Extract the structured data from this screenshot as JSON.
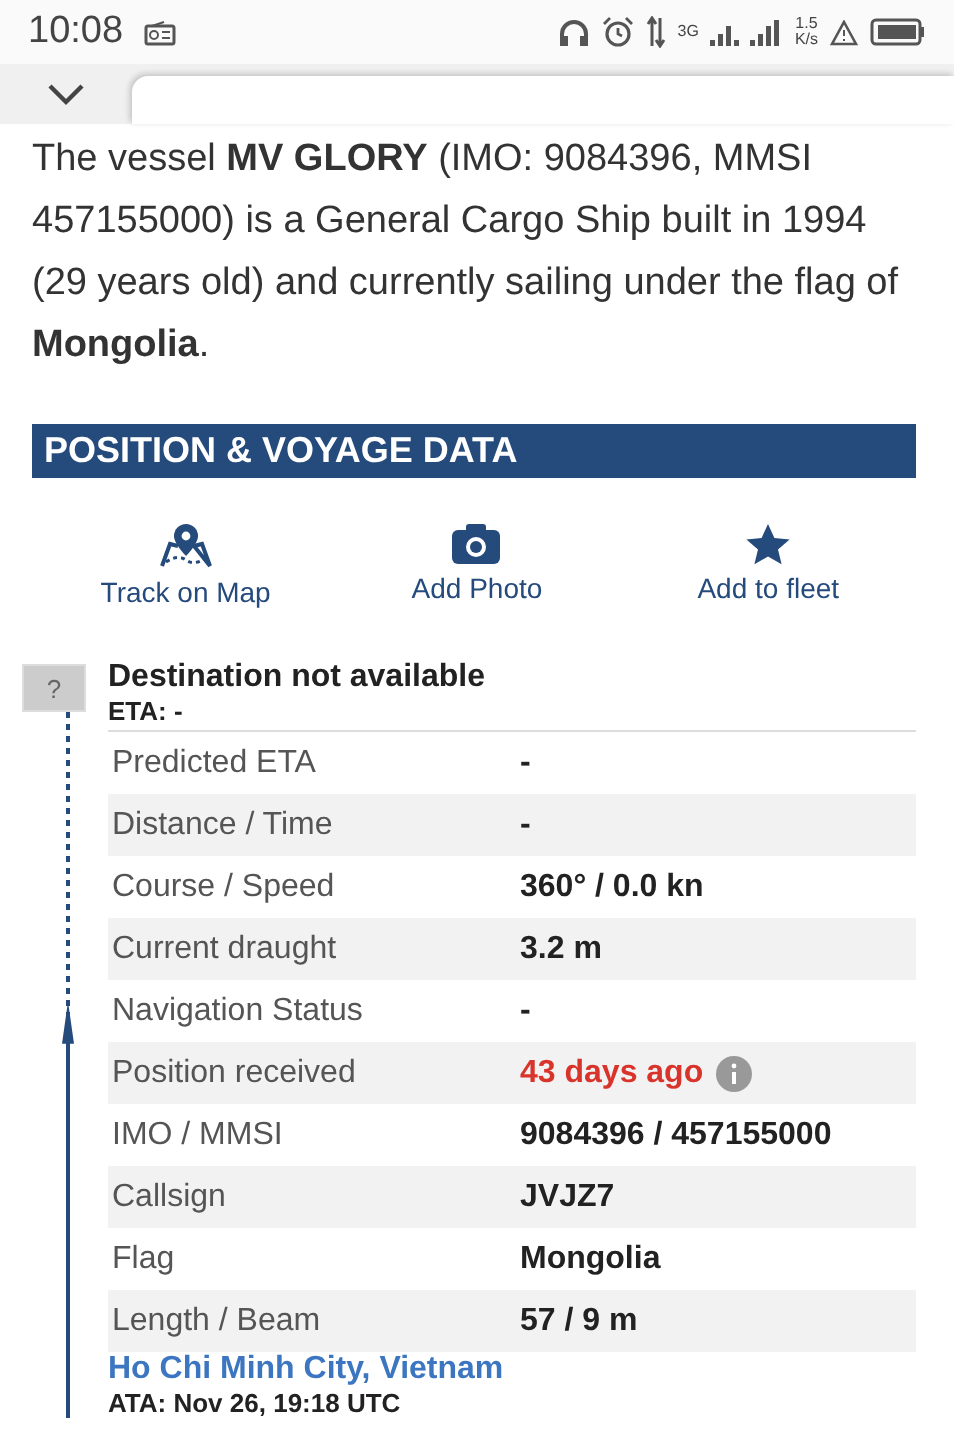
{
  "status_bar": {
    "time": "10:08",
    "network": "3G",
    "speed_value": "1.5",
    "speed_unit": "K/s"
  },
  "intro": "The vessel **MV GLORY** (IMO: 9084396, MMSI 457155000) is a General Cargo Ship built in 1994 (29 years old) and currently sailing under the flag of **Mongolia**.",
  "section_title": "POSITION & VOYAGE DATA",
  "actions": [
    {
      "kind": "map",
      "label": "Track on Map"
    },
    {
      "kind": "camera",
      "label": "Add Photo"
    },
    {
      "kind": "star",
      "label": "Add to fleet"
    }
  ],
  "destination": {
    "flag": "?",
    "title": "Destination not available",
    "eta": "ETA: -"
  },
  "rows": [
    {
      "label": "Predicted ETA",
      "value": "-"
    },
    {
      "label": "Distance / Time",
      "value": "-"
    },
    {
      "label": "Course / Speed",
      "value": "360° / 0.0 kn"
    },
    {
      "label": "Current draught",
      "value": "3.2 m"
    },
    {
      "label": "Navigation Status",
      "value": "-"
    },
    {
      "label": "Position received",
      "value": "43 days ago",
      "kind": "alert"
    },
    {
      "label": "IMO / MMSI",
      "value": "9084396 / 457155000"
    },
    {
      "label": "Callsign",
      "value": "JVJZ7"
    },
    {
      "label": "Flag",
      "value": "Mongolia"
    },
    {
      "label": "Length / Beam",
      "value": "57 / 9 m"
    }
  ],
  "departure": {
    "port": "Ho Chi Minh City, Vietnam",
    "ata": "ATA: Nov 26, 19:18 UTC"
  }
}
